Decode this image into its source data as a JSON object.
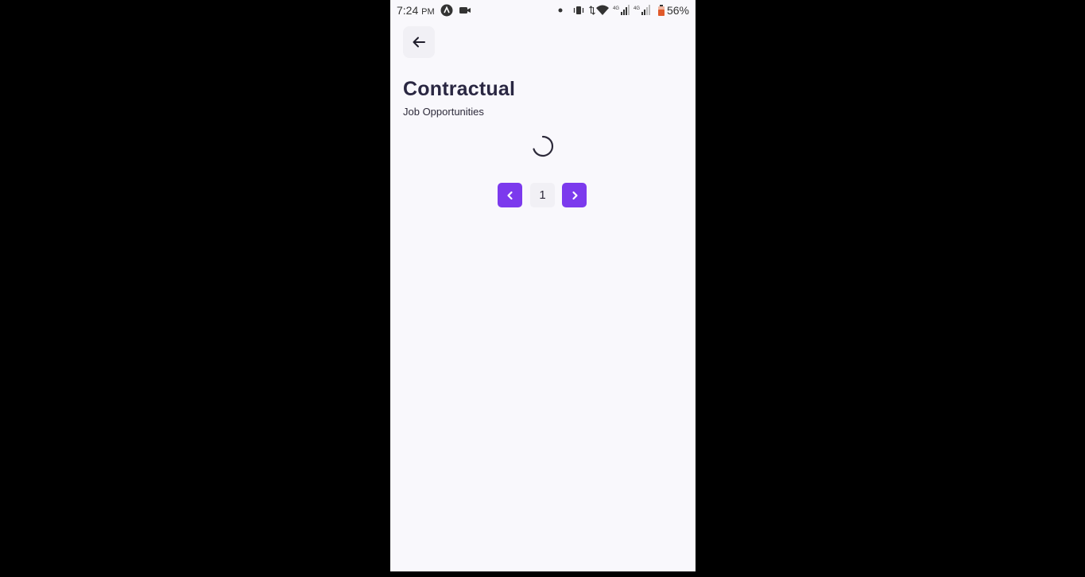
{
  "status_bar": {
    "time": "7:24",
    "ampm": "PM",
    "battery": "56%",
    "icons": [
      "app-icon",
      "video-camera-icon",
      "dot-icon",
      "vibrate-icon",
      "data-arrows-icon",
      "wifi-icon",
      "signal-icon",
      "signal-icon",
      "battery-icon"
    ]
  },
  "header": {
    "back_icon": "arrow-left-icon",
    "title": "Contractual",
    "subtitle": "Job Opportunities"
  },
  "pagination": {
    "current_page": "1",
    "prev_icon": "chevron-left-icon",
    "next_icon": "chevron-right-icon"
  },
  "colors": {
    "accent": "#7c3aed",
    "background": "#f9f8fc",
    "text": "#2a2742"
  }
}
